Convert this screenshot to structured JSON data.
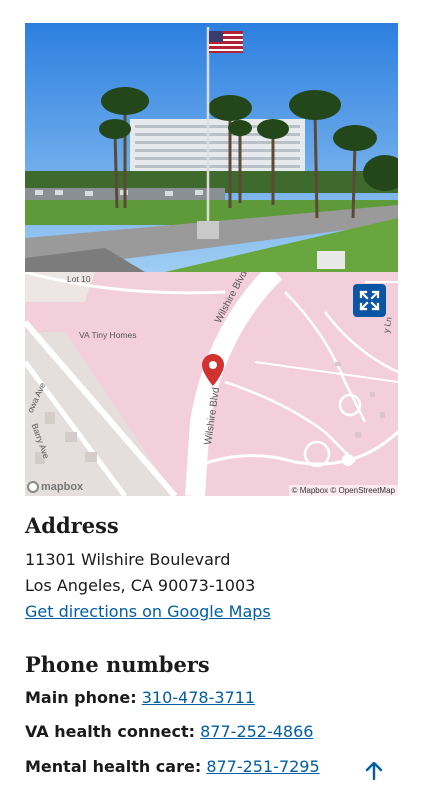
{
  "photo": {
    "alt_icon": "facility-photo"
  },
  "map": {
    "labels": {
      "lot": "Lot 10",
      "tiny_homes": "VA Tiny Homes",
      "wilshire_top": "Wilshire Blvd",
      "wilshire_bottom": "Wilshire Blvd",
      "iowa_ave": "owa Ave",
      "barry_ave": "Barry Ave",
      "lane": "y Ln"
    },
    "logo_text": "mapbox",
    "attribution": "© Mapbox © OpenStreetMap",
    "expand_icon": "expand-icon",
    "pin_icon": "map-pin-icon"
  },
  "address": {
    "heading": "Address",
    "line1": "11301 Wilshire Boulevard",
    "line2": "Los Angeles, CA 90073-1003",
    "directions_link": "Get directions on Google Maps"
  },
  "phones": {
    "heading": "Phone numbers",
    "items": [
      {
        "label": "Main phone:",
        "number": "310-478-3711"
      },
      {
        "label": "VA health connect:",
        "number": "877-252-4866"
      },
      {
        "label": "Mental health care:",
        "number": "877-251-7295"
      }
    ]
  },
  "colors": {
    "link": "#005ea2",
    "expand_button": "#0b56a4",
    "map_bg": "#f3cfdc",
    "pin": "#d1322f"
  },
  "back_to_top_icon": "arrow-up-icon"
}
